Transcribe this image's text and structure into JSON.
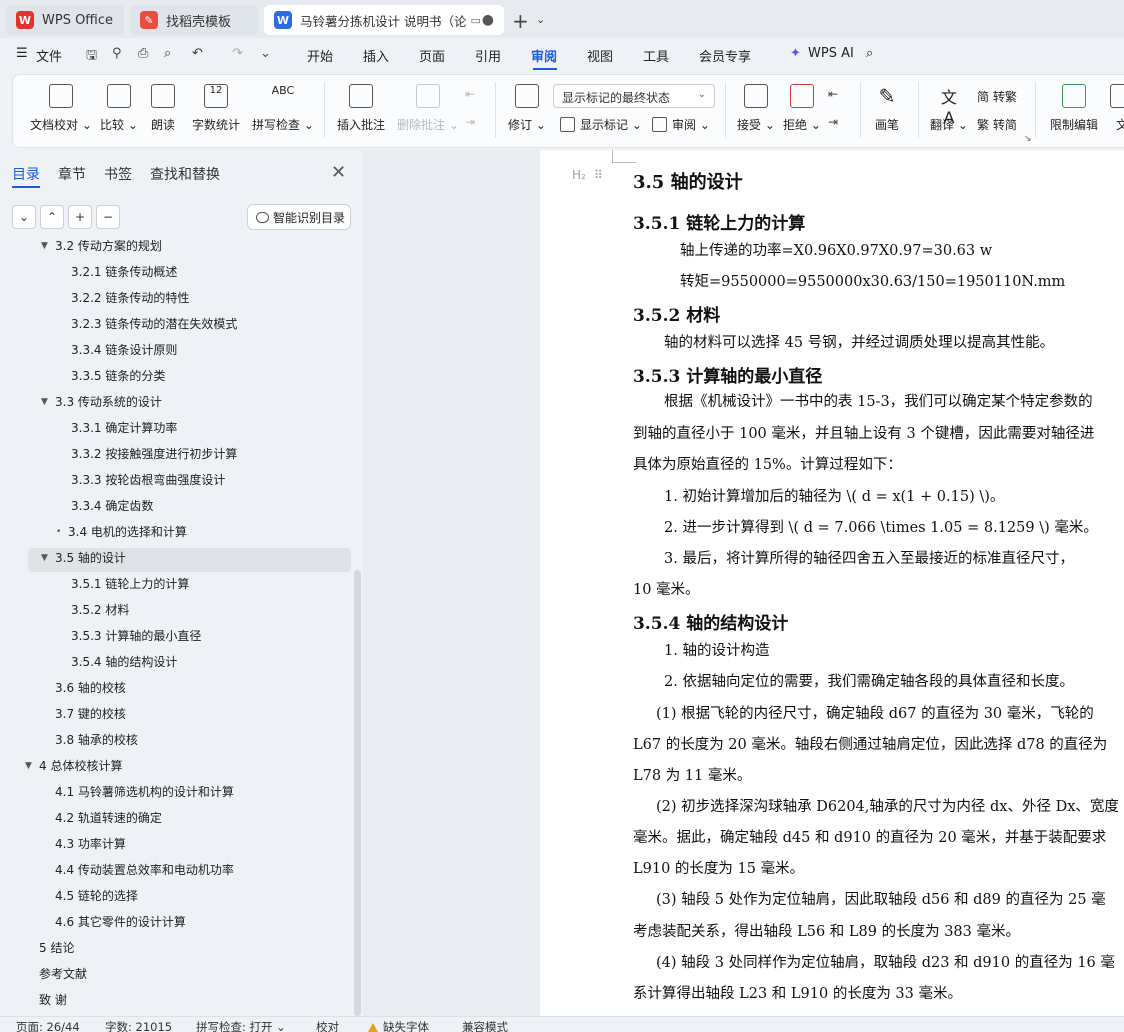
{
  "tabs": {
    "wps_office": "WPS Office",
    "templates": "找稻壳模板",
    "document": "马铃薯分拣机设计 说明书（论"
  },
  "menu": {
    "file": "文件",
    "items": [
      "开始",
      "插入",
      "页面",
      "引用",
      "审阅",
      "视图",
      "工具",
      "会员专享"
    ],
    "active": "审阅",
    "ai": "WPS AI"
  },
  "ribbon": {
    "doc_check": "文档校对",
    "compare": "比较",
    "read_aloud": "朗读",
    "word_count": "字数统计",
    "spell_check": "拼写检查",
    "insert_comment": "插入批注",
    "delete_comment": "删除批注",
    "revise": "修订",
    "display_mode": "显示标记的最终状态",
    "show_markup": "显示标记",
    "review": "审阅",
    "accept": "接受",
    "reject": "拒绝",
    "pen": "画笔",
    "translate": "翻译",
    "to_traditional": "简 转繁",
    "to_simplified": "繁 转简",
    "restrict_edit": "限制编辑",
    "doc_more": "文"
  },
  "sidebar": {
    "tabs": [
      "目录",
      "章节",
      "书签",
      "查找和替换"
    ],
    "smart_toc": "智能识别目录",
    "toc": [
      {
        "text": "3.2  传动方案的规划",
        "level": 2,
        "caret": "▼"
      },
      {
        "text": "3.2.1  链条传动概述",
        "level": 3
      },
      {
        "text": "3.2.2  链条传动的特性",
        "level": 3
      },
      {
        "text": "3.2.3  链条传动的潜在失效模式",
        "level": 3
      },
      {
        "text": "3.3.4  链条设计原则",
        "level": 3
      },
      {
        "text": "3.3.5  链条的分类",
        "level": 3
      },
      {
        "text": "3.3 传动系统的设计",
        "level": 2,
        "caret": "▼"
      },
      {
        "text": "3.3.1 确定计算功率",
        "level": 3
      },
      {
        "text": "3.3.2 按接触强度进行初步计算",
        "level": 3
      },
      {
        "text": "3.3.3 按轮齿根弯曲强度设计",
        "level": 3
      },
      {
        "text": "3.3.4 确定齿数",
        "level": 3
      },
      {
        "text": "3.4 电机的选择和计算",
        "level": 2,
        "caret": "•"
      },
      {
        "text": "3.5 轴的设计",
        "level": 2,
        "caret": "▼",
        "selected": true
      },
      {
        "text": "3.5.1 链轮上力的计算",
        "level": 3
      },
      {
        "text": "3.5.2 材料",
        "level": 3
      },
      {
        "text": "3.5.3 计算轴的最小直径",
        "level": 3
      },
      {
        "text": "3.5.4 轴的结构设计",
        "level": 3
      },
      {
        "text": "3.6 轴的校核",
        "level": 2
      },
      {
        "text": "3.7 键的校核",
        "level": 2
      },
      {
        "text": "3.8 轴承的校核",
        "level": 2
      },
      {
        "text": "4  总体校核计算",
        "level": 1,
        "caret": "▼"
      },
      {
        "text": "4.1  马铃薯筛选机构的设计和计算",
        "level": 2
      },
      {
        "text": "4.2  轨道转速的确定",
        "level": 2
      },
      {
        "text": "4.3  功率计算",
        "level": 2
      },
      {
        "text": "4.4  传动装置总效率和电动机功率",
        "level": 2
      },
      {
        "text": "4.5  链轮的选择",
        "level": 2
      },
      {
        "text": "4.6 其它零件的设计计算",
        "level": 2
      },
      {
        "text": "5 结论",
        "level": 1
      },
      {
        "text": "参考文献",
        "level": 1
      },
      {
        "text": "致    谢",
        "level": 1
      }
    ]
  },
  "document": {
    "h2_marker": "H₂",
    "lines": [
      {
        "text": "3.5 轴的设计",
        "style": "h"
      },
      {
        "text": "3.5.1 链轮上力的计算",
        "style": "h3"
      },
      {
        "text": "轴上传递的功率=X0.96X0.97X0.97=30.63 w",
        "style": "p"
      },
      {
        "text": "转矩=9550000=9550000x30.63/150=1950110N.mm",
        "style": "p"
      },
      {
        "text": "3.5.2 材料",
        "style": "h3"
      },
      {
        "text": "轴的材料可以选择 45 号钢，并经过调质处理以提高其性能。",
        "style": "p"
      },
      {
        "text": "3.5.3 计算轴的最小直径",
        "style": "h3"
      },
      {
        "text": "根据《机械设计》一书中的表 15-3，我们可以确定某个特定参数的",
        "style": "p"
      },
      {
        "text": "到轴的直径小于 100 毫米，并且轴上设有 3 个键槽，因此需要对轴径进",
        "style": "p"
      },
      {
        "text": "具体为原始直径的 15%。计算过程如下：",
        "style": "p"
      },
      {
        "text": "1. 初始计算增加后的轴径为  \\( d = x(1 + 0.15) \\)。",
        "style": "p"
      },
      {
        "text": "2. 进一步计算得到  \\( d = 7.066 \\times 1.05 = 8.1259 \\)  毫米。",
        "style": "p"
      },
      {
        "text": "3. 最后，将计算所得的轴径四舍五入至最接近的标准直径尺寸，",
        "style": "p"
      },
      {
        "text": "10 毫米。",
        "style": "p"
      },
      {
        "text": "3.5.4 轴的结构设计",
        "style": "h3"
      },
      {
        "text": "1. 轴的设计构造",
        "style": "p"
      },
      {
        "text": "2. 依据轴向定位的需要，我们需确定轴各段的具体直径和长度。",
        "style": "p"
      },
      {
        "text": "(1) 根据飞轮的内径尺寸，确定轴段 d67 的直径为 30 毫米，飞轮的",
        "style": "p"
      },
      {
        "text": "L67 的长度为 20 毫米。轴段右侧通过轴肩定位，因此选择 d78 的直径为",
        "style": "p"
      },
      {
        "text": "L78 为 11 毫米。",
        "style": "p"
      },
      {
        "text": "(2) 初步选择深沟球轴承 D6204,轴承的尺寸为内径 dx、外径 Dx、宽度",
        "style": "p"
      },
      {
        "text": "毫米。据此，确定轴段 d45 和 d910 的直径为 20 毫米，并基于装配要求",
        "style": "p"
      },
      {
        "text": "L910 的长度为 15 毫米。",
        "style": "p"
      },
      {
        "text": "(3) 轴段 5 处作为定位轴肩，因此取轴段 d56 和 d89 的直径为 25 毫",
        "style": "p"
      },
      {
        "text": "考虑装配关系，得出轴段 L56 和 L89 的长度为 383 毫米。",
        "style": "p"
      },
      {
        "text": "(4) 轴段 3 处同样作为定位轴肩，取轴段 d23 和 d910 的直径为 16 毫",
        "style": "p"
      },
      {
        "text": "系计算得出轴段 L23 和 L910 的长度为 33 毫米。",
        "style": "p"
      }
    ]
  },
  "status": {
    "page": "页面: 26/44",
    "words": "字数: 21015",
    "spell": "拼写检查: 打开",
    "proof": "校对",
    "missing_font": "缺失字体",
    "compat": "兼容模式"
  },
  "colors": {
    "accent": "#1a5be0",
    "wps_red": "#e3322b"
  }
}
